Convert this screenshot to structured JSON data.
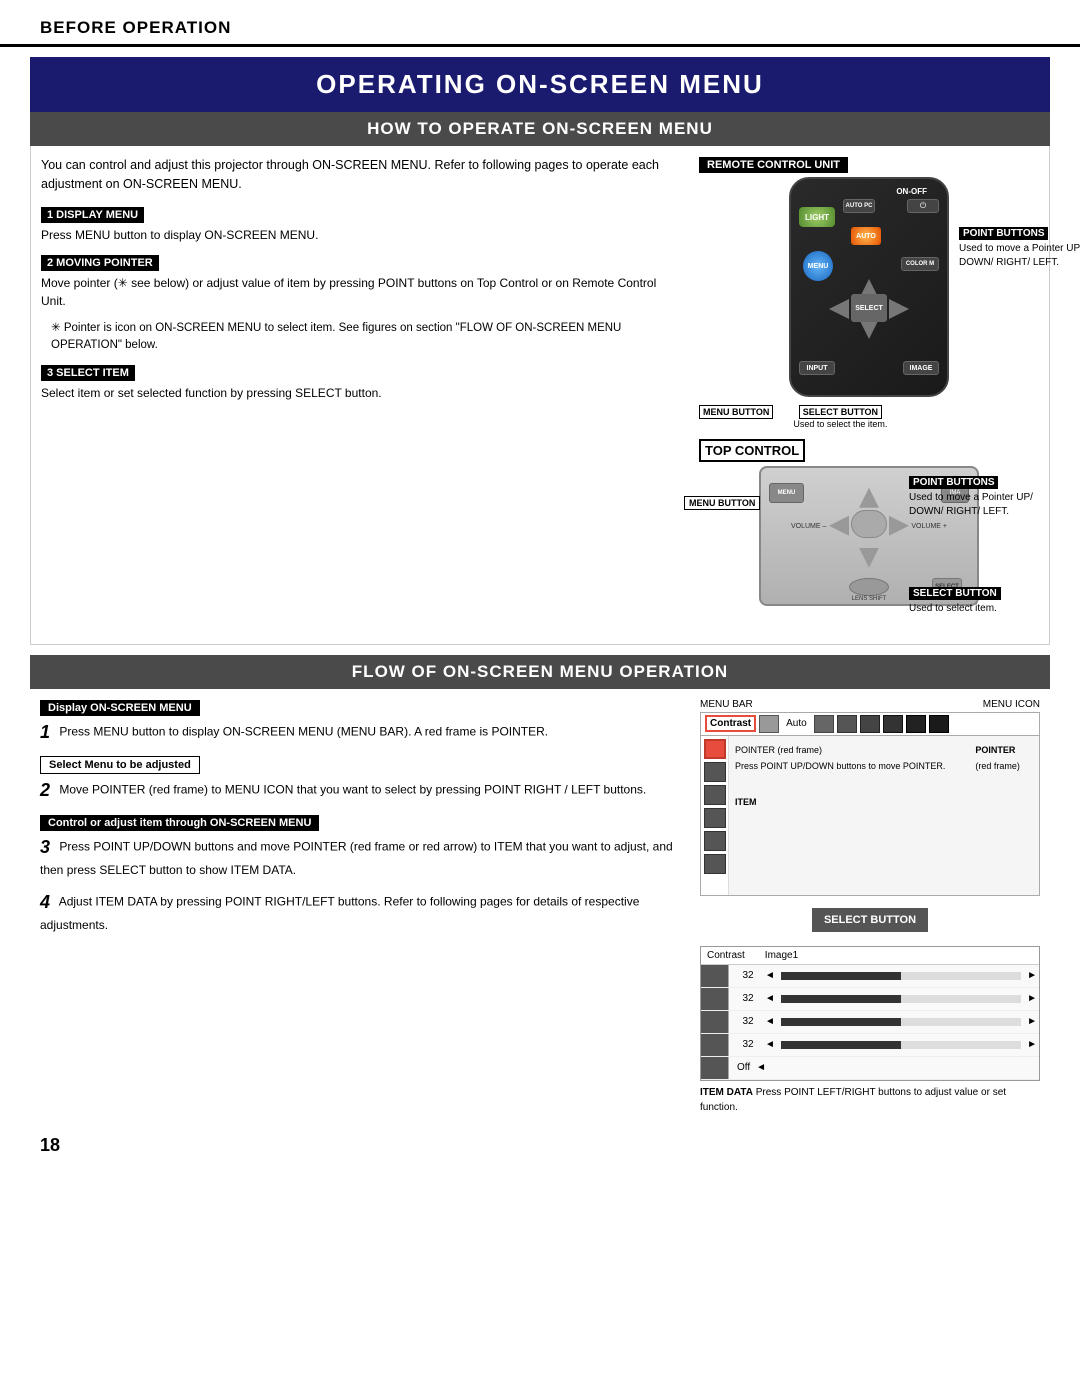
{
  "page": {
    "number": "18",
    "header": "BEFORE OPERATION",
    "main_title": "OPERATING ON-SCREEN MENU",
    "section1_title": "HOW TO OPERATE ON-SCREEN MENU",
    "section2_title": "FLOW OF ON-SCREEN MENU OPERATION"
  },
  "how_to": {
    "intro": "You can control and adjust this projector through ON-SCREEN MENU.  Refer to following pages to operate each adjustment on ON-SCREEN MENU.",
    "step1_label": "1  DISPLAY MENU",
    "step1_text": "Press MENU button to display ON-SCREEN MENU.",
    "step2_label": "2  MOVING POINTER",
    "step2_text": "Move pointer (✳ see below) or adjust value of item by pressing POINT buttons on Top Control or on Remote Control Unit.",
    "step2_note": "✳ Pointer is icon on ON-SCREEN MENU to select item.  See figures on section \"FLOW OF ON-SCREEN MENU OPERATION\" below.",
    "step3_label": "3  SELECT ITEM",
    "step3_text": "Select item or set selected function by pressing SELECT button."
  },
  "remote_control": {
    "label": "REMOTE CONTROL UNIT",
    "point_buttons_label": "POINT BUTTONS",
    "point_buttons_desc": "Used to move a Pointer UP/ DOWN/ RIGHT/ LEFT.",
    "menu_button_label": "MENU BUTTON",
    "select_button_label": "SELECT BUTTON",
    "select_button_desc": "Used to select the item."
  },
  "top_control": {
    "label": "TOP CONTROL",
    "point_buttons_label": "POINT BUTTONS",
    "point_buttons_desc": "Used to move a Pointer UP/ DOWN/ RIGHT/ LEFT.",
    "menu_button_label": "MENU BUTTON",
    "select_button_label": "SELECT BUTTON",
    "select_button_desc": "Used to select item.",
    "volume_minus": "VOLUME –",
    "volume_plus": "VOLUME +",
    "lens_shift": "LENS SHIFT",
    "select": "SELECT"
  },
  "flow": {
    "step1_label": "Display ON-SCREEN MENU",
    "step1_num": "1",
    "step1_text": "Press MENU button to display ON-SCREEN MENU (MENU BAR).  A red frame is POINTER.",
    "step2_label": "Select Menu to be adjusted",
    "step2_num": "2",
    "step2_text": "Move POINTER (red frame) to MENU ICON that you want to select by pressing POINT RIGHT / LEFT buttons.",
    "step3_label": "Control or adjust item through ON-SCREEN MENU",
    "step3_num": "3",
    "step3_text": "Press POINT UP/DOWN buttons and move POINTER (red frame or red arrow) to ITEM that you want to adjust, and then press SELECT button to show ITEM DATA.",
    "step4_num": "4",
    "step4_text": "Adjust ITEM DATA by pressing POINT RIGHT/LEFT buttons.  Refer to following pages for details of respective adjustments.",
    "menu_bar_label": "MENU BAR",
    "menu_icon_label": "MENU ICON",
    "pointer_red_frame_label": "POINTER (red frame)",
    "pointer_label": "POINTER",
    "pointer_red_frame_desc": "Press POINT UP/DOWN buttons to move POINTER.",
    "pointer_desc": "(red frame)",
    "item_label": "ITEM",
    "select_button": "SELECT\nBUTTON",
    "item_data_label": "ITEM DATA",
    "item_data_desc": "Press POINT LEFT/RIGHT buttons to adjust value or set function.",
    "menu_first_item": "Contrast",
    "menu_auto": "Auto",
    "item_data_header_left": "Contrast",
    "item_data_header_right": "Image1",
    "item_values": [
      "32",
      "32",
      "32",
      "32",
      "Off"
    ]
  }
}
